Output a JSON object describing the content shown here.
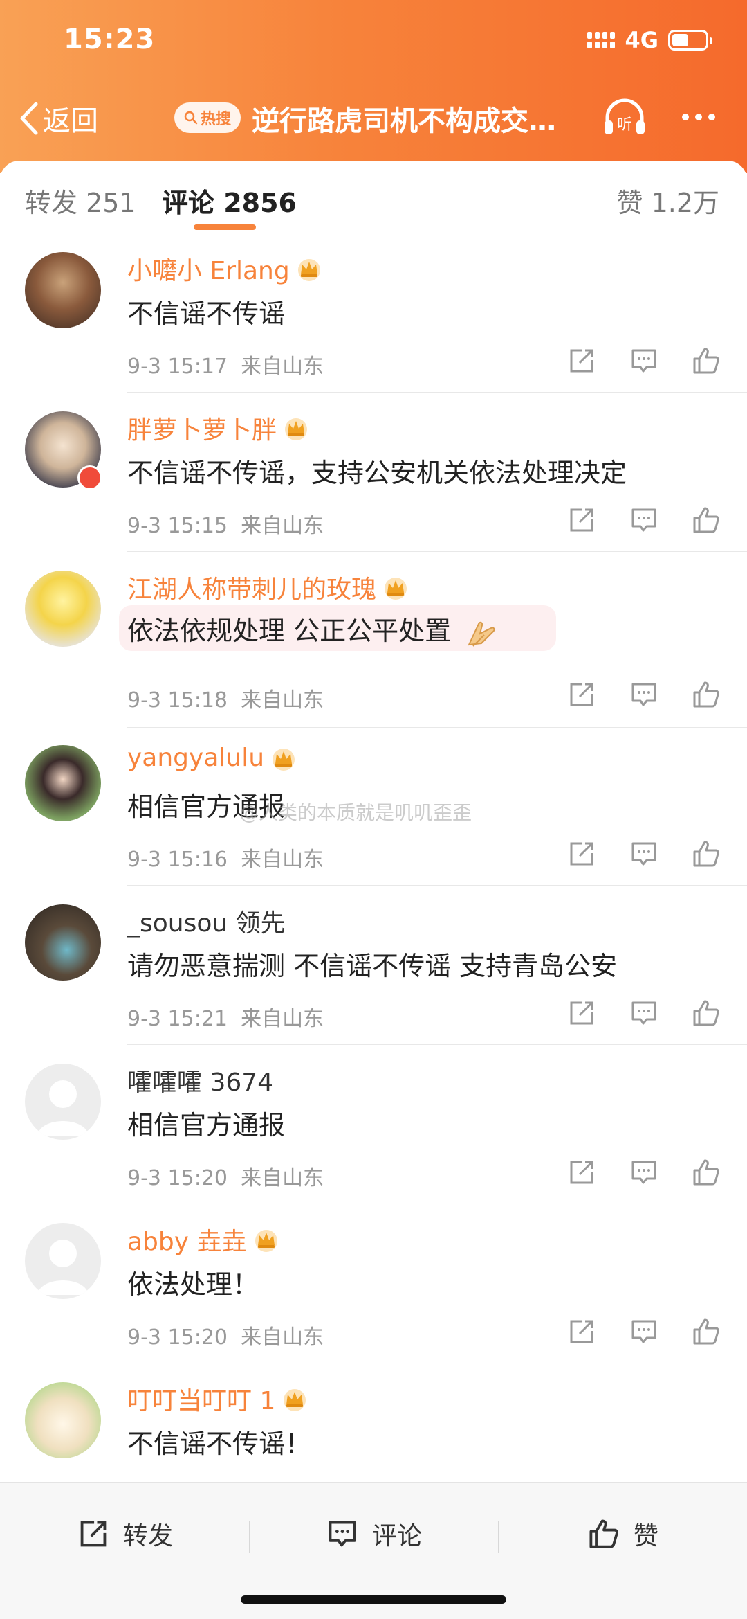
{
  "status_bar": {
    "time": "15:23",
    "network": "4G"
  },
  "nav": {
    "back_label": "返回",
    "hot_label": "热搜",
    "title": "逆行路虎司机不构成交…"
  },
  "tabs": {
    "forward": "转发 251",
    "comment": "评论 2856",
    "like": "赞 1.2万"
  },
  "comments": [
    {
      "author": "小嚰小 Erlang",
      "vip": true,
      "text": "不信谣不传谣",
      "time": "9-3 15:17",
      "source": "来自山东"
    },
    {
      "author": "胖萝卜萝卜胖",
      "vip": true,
      "text": "不信谣不传谣，支持公安机关依法处理决定",
      "time": "9-3 15:15",
      "source": "来自山东"
    },
    {
      "author": "江湖人称带刺儿的玫瑰",
      "vip": true,
      "text": "依法依规处理 公正公平处置",
      "time": "9-3 15:18",
      "source": "来自山东"
    },
    {
      "author": "yangyalulu",
      "vip": true,
      "text": "相信官方通报",
      "time": "9-3 15:16",
      "source": "来自山东"
    },
    {
      "author": "_sousou 领先",
      "vip": false,
      "text": "请勿恶意揣测 不信谣不传谣 支持青岛公安",
      "time": "9-3 15:21",
      "source": "来自山东"
    },
    {
      "author": "嚯嚯嚯 3674",
      "vip": false,
      "text": "相信官方通报",
      "time": "9-3 15:20",
      "source": "来自山东"
    },
    {
      "author": "abby 垚垚",
      "vip": true,
      "text": "依法处理！",
      "time": "9-3 15:20",
      "source": "来自山东"
    },
    {
      "author": "叮叮当叮叮 1",
      "vip": true,
      "text": "不信谣不传谣！"
    }
  ],
  "watermark": "@人类的本质就是叽叽歪歪",
  "bottom_bar": {
    "forward": "转发",
    "comment": "评论",
    "like": "赞"
  },
  "colors": {
    "accent": "#f7833b",
    "header_start": "#f9a155",
    "header_end": "#f56a2c"
  }
}
